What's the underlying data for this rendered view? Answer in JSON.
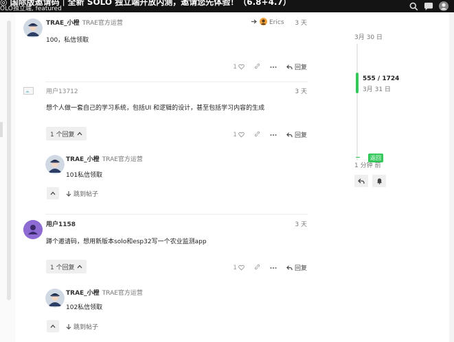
{
  "header": {
    "title": "◎ 国际版邀请码｜全新 SOLO 独立端开放内测，邀请您先体验！（6.8+4.7）",
    "subtitle": "OLO独立端, featured"
  },
  "timeline": {
    "top_date": "3月 30 日",
    "position": "555 / 1724",
    "current_date": "3月 31 日",
    "back_label": "返回",
    "ago": "1 分钟 前"
  },
  "posts": [
    {
      "username": "TRAE_小橙",
      "user_title": "TRAE官方运营",
      "reply_to": "Erics",
      "date": "3 天",
      "body": "100，私信领取",
      "likes": "1",
      "reply_label": "回复"
    },
    {
      "username": "用户13712",
      "date": "3 天",
      "body": "想个人做一套自己的学习系统，包括UI 和逻辑的设计，甚至包括学习内容的生成",
      "likes": "1",
      "reply_label": "回复",
      "replies_count": "1 个回复",
      "nested": {
        "username": "TRAE_小橙",
        "user_title": "TRAE官方运营",
        "body": "101私信领取",
        "jump_label": "跳到帖子"
      }
    },
    {
      "username": "用户1158",
      "date": "3 天",
      "body": "蹲个邀请码，想用新版本solo和esp32写一个农业监测app",
      "likes": "1",
      "reply_label": "回复",
      "replies_count": "1 个回复",
      "nested": {
        "username": "TRAE_小橙",
        "user_title": "TRAE官方运营",
        "body": "102私信领取",
        "jump_label": "跳到帖子"
      }
    }
  ]
}
